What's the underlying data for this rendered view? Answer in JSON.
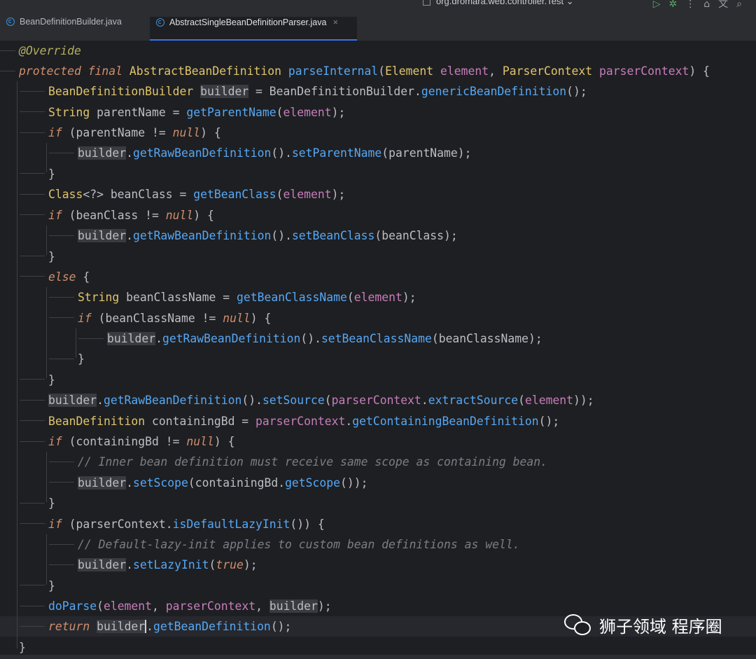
{
  "topbar": {
    "project_label": "org.dromara.web.controller.Test",
    "icons": [
      "run-icon",
      "debug-icon",
      "more-icon",
      "vcs-icon",
      "translate-icon",
      "search-icon"
    ]
  },
  "tabs": [
    {
      "label": "BeanDefinitionBuilder.java",
      "active": false
    },
    {
      "label": "AbstractSingleBeanDefinitionParser.java",
      "active": true,
      "close": "×"
    }
  ],
  "code": {
    "l1": "@Override",
    "l2_a": "protected",
    "l2_b": "final",
    "l2_c": "AbstractBeanDefinition",
    "l2_d": "parseInternal",
    "l2_e": "(",
    "l2_f": "Element",
    "l2_g": "element",
    "l2_h": ", ",
    "l2_i": "ParserContext",
    "l2_j": "parserContext",
    "l2_k": ") {",
    "l3_a": "BeanDefinitionBuilder",
    "l3_b": "builder",
    "l3_c": " = BeanDefinitionBuilder.",
    "l3_d": "genericBeanDefinition",
    "l3_e": "();",
    "l4_a": "String",
    "l4_b": " parentName = ",
    "l4_c": "getParentName",
    "l4_d": "(",
    "l4_e": "element",
    "l4_f": ");",
    "l5_a": "if",
    "l5_b": " (parentName != ",
    "l5_c": "null",
    "l5_d": ") {",
    "l6_a": "builder",
    "l6_b": ".",
    "l6_c": "getRawBeanDefinition",
    "l6_d": "().",
    "l6_e": "setParentName",
    "l6_f": "(parentName);",
    "l7": "}",
    "l8_a": "Class",
    "l8_b": "<?> beanClass = ",
    "l8_c": "getBeanClass",
    "l8_d": "(",
    "l8_e": "element",
    "l8_f": ");",
    "l9_a": "if",
    "l9_b": " (beanClass != ",
    "l9_c": "null",
    "l9_d": ") {",
    "l10_a": "builder",
    "l10_b": ".",
    "l10_c": "getRawBeanDefinition",
    "l10_d": "().",
    "l10_e": "setBeanClass",
    "l10_f": "(beanClass);",
    "l11": "}",
    "l12_a": "else",
    "l12_b": " {",
    "l13_a": "String",
    "l13_b": " beanClassName = ",
    "l13_c": "getBeanClassName",
    "l13_d": "(",
    "l13_e": "element",
    "l13_f": ");",
    "l14_a": "if",
    "l14_b": " (beanClassName != ",
    "l14_c": "null",
    "l14_d": ") {",
    "l15_a": "builder",
    "l15_b": ".",
    "l15_c": "getRawBeanDefinition",
    "l15_d": "().",
    "l15_e": "setBeanClassName",
    "l15_f": "(beanClassName);",
    "l16": "}",
    "l17": "}",
    "l18_a": "builder",
    "l18_b": ".",
    "l18_c": "getRawBeanDefinition",
    "l18_d": "().",
    "l18_e": "setSource",
    "l18_f": "(",
    "l18_g": "parserContext",
    "l18_h": ".",
    "l18_i": "extractSource",
    "l18_j": "(",
    "l18_k": "element",
    "l18_l": "));",
    "l19_a": "BeanDefinition",
    "l19_b": " containingBd = ",
    "l19_c": "parserContext",
    "l19_d": ".",
    "l19_e": "getContainingBeanDefinition",
    "l19_f": "();",
    "l20_a": "if",
    "l20_b": " (containingBd != ",
    "l20_c": "null",
    "l20_d": ") {",
    "l21": "// Inner bean definition must receive same scope as containing bean.",
    "l22_a": "builder",
    "l22_b": ".",
    "l22_c": "setScope",
    "l22_d": "(containingBd.",
    "l22_e": "getScope",
    "l22_f": "());",
    "l23": "}",
    "l24_a": "if",
    "l24_b": " (parserContext.",
    "l24_c": "isDefaultLazyInit",
    "l24_d": "()) {",
    "l25": "// Default-lazy-init applies to custom bean definitions as well.",
    "l26_a": "builder",
    "l26_b": ".",
    "l26_c": "setLazyInit",
    "l26_d": "(",
    "l26_e": "true",
    "l26_f": ");",
    "l27": "}",
    "l28_a": "doParse",
    "l28_b": "(",
    "l28_c": "element",
    "l28_d": ", ",
    "l28_e": "parserContext",
    "l28_f": ", ",
    "l28_g": "builder",
    "l28_h": ");",
    "l29_a": "return",
    "l29_b": "builder",
    "l29_c": ".",
    "l29_d": "getBeanDefinition",
    "l29_e": "();",
    "l30": "}"
  },
  "watermark": {
    "text": "狮子领域 程序圈",
    "icon": "wechat-icon"
  }
}
